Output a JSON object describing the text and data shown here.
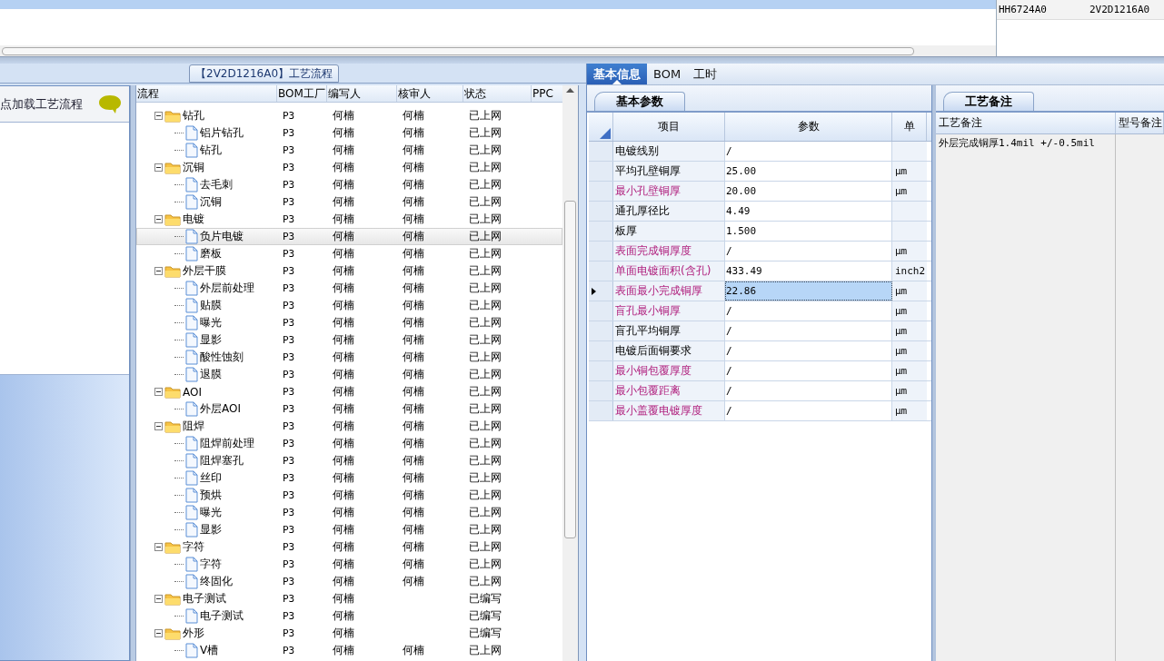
{
  "top_grid": {
    "right_row": [
      "HH6724A0",
      "2V2D1216A0"
    ]
  },
  "flow_panel": {
    "title": "【2V2D1216A0】工艺流程",
    "node_header": "点加载工艺流程",
    "columns": [
      "流程",
      "BOM工厂",
      "编写人",
      "核审人",
      "状态",
      "PPC"
    ],
    "tree": [
      {
        "name": "钻孔",
        "bom": "P3",
        "writer": "何楠",
        "reviewer": "何楠",
        "status": "已上网",
        "selected": false,
        "expanded": true,
        "children": [
          {
            "name": "铝片钻孔",
            "bom": "P3",
            "writer": "何楠",
            "reviewer": "何楠",
            "status": "已上网",
            "selected": false
          },
          {
            "name": "钻孔",
            "bom": "P3",
            "writer": "何楠",
            "reviewer": "何楠",
            "status": "已上网",
            "selected": false
          }
        ]
      },
      {
        "name": "沉铜",
        "bom": "P3",
        "writer": "何楠",
        "reviewer": "何楠",
        "status": "已上网",
        "selected": false,
        "expanded": true,
        "children": [
          {
            "name": "去毛刺",
            "bom": "P3",
            "writer": "何楠",
            "reviewer": "何楠",
            "status": "已上网",
            "selected": false
          },
          {
            "name": "沉铜",
            "bom": "P3",
            "writer": "何楠",
            "reviewer": "何楠",
            "status": "已上网",
            "selected": false
          }
        ]
      },
      {
        "name": "电镀",
        "bom": "P3",
        "writer": "何楠",
        "reviewer": "何楠",
        "status": "已上网",
        "selected": false,
        "expanded": true,
        "children": [
          {
            "name": "负片电镀",
            "bom": "P3",
            "writer": "何楠",
            "reviewer": "何楠",
            "status": "已上网",
            "selected": true
          },
          {
            "name": "磨板",
            "bom": "P3",
            "writer": "何楠",
            "reviewer": "何楠",
            "status": "已上网",
            "selected": false
          }
        ]
      },
      {
        "name": "外层干膜",
        "bom": "P3",
        "writer": "何楠",
        "reviewer": "何楠",
        "status": "已上网",
        "selected": false,
        "expanded": true,
        "children": [
          {
            "name": "外层前处理",
            "bom": "P3",
            "writer": "何楠",
            "reviewer": "何楠",
            "status": "已上网",
            "selected": false
          },
          {
            "name": "贴膜",
            "bom": "P3",
            "writer": "何楠",
            "reviewer": "何楠",
            "status": "已上网",
            "selected": false
          },
          {
            "name": "曝光",
            "bom": "P3",
            "writer": "何楠",
            "reviewer": "何楠",
            "status": "已上网",
            "selected": false
          },
          {
            "name": "显影",
            "bom": "P3",
            "writer": "何楠",
            "reviewer": "何楠",
            "status": "已上网",
            "selected": false
          },
          {
            "name": "酸性蚀刻",
            "bom": "P3",
            "writer": "何楠",
            "reviewer": "何楠",
            "status": "已上网",
            "selected": false
          },
          {
            "name": "退膜",
            "bom": "P3",
            "writer": "何楠",
            "reviewer": "何楠",
            "status": "已上网",
            "selected": false
          }
        ]
      },
      {
        "name": "AOI",
        "bom": "P3",
        "writer": "何楠",
        "reviewer": "何楠",
        "status": "已上网",
        "selected": false,
        "expanded": true,
        "children": [
          {
            "name": "外层AOI",
            "bom": "P3",
            "writer": "何楠",
            "reviewer": "何楠",
            "status": "已上网",
            "selected": false
          }
        ]
      },
      {
        "name": "阻焊",
        "bom": "P3",
        "writer": "何楠",
        "reviewer": "何楠",
        "status": "已上网",
        "selected": false,
        "expanded": true,
        "children": [
          {
            "name": "阻焊前处理",
            "bom": "P3",
            "writer": "何楠",
            "reviewer": "何楠",
            "status": "已上网",
            "selected": false
          },
          {
            "name": "阻焊塞孔",
            "bom": "P3",
            "writer": "何楠",
            "reviewer": "何楠",
            "status": "已上网",
            "selected": false
          },
          {
            "name": "丝印",
            "bom": "P3",
            "writer": "何楠",
            "reviewer": "何楠",
            "status": "已上网",
            "selected": false
          },
          {
            "name": "预烘",
            "bom": "P3",
            "writer": "何楠",
            "reviewer": "何楠",
            "status": "已上网",
            "selected": false
          },
          {
            "name": "曝光",
            "bom": "P3",
            "writer": "何楠",
            "reviewer": "何楠",
            "status": "已上网",
            "selected": false
          },
          {
            "name": "显影",
            "bom": "P3",
            "writer": "何楠",
            "reviewer": "何楠",
            "status": "已上网",
            "selected": false
          }
        ]
      },
      {
        "name": "字符",
        "bom": "P3",
        "writer": "何楠",
        "reviewer": "何楠",
        "status": "已上网",
        "selected": false,
        "expanded": true,
        "children": [
          {
            "name": "字符",
            "bom": "P3",
            "writer": "何楠",
            "reviewer": "何楠",
            "status": "已上网",
            "selected": false
          },
          {
            "name": "终固化",
            "bom": "P3",
            "writer": "何楠",
            "reviewer": "何楠",
            "status": "已上网",
            "selected": false
          }
        ]
      },
      {
        "name": "电子测试",
        "bom": "P3",
        "writer": "何楠",
        "status": "已编写",
        "selected": false,
        "expanded": true,
        "children": [
          {
            "name": "电子测试",
            "bom": "P3",
            "writer": "何楠",
            "status": "已编写",
            "selected": false
          }
        ]
      },
      {
        "name": "外形",
        "bom": "P3",
        "writer": "何楠",
        "status": "已编写",
        "selected": false,
        "expanded": true,
        "children": [
          {
            "name": "V槽",
            "bom": "P3",
            "writer": "何楠",
            "reviewer": "何楠",
            "status": "已上网",
            "selected": false
          }
        ]
      }
    ]
  },
  "detail_tabs": [
    {
      "label": "基本信息",
      "selected": true
    },
    {
      "label": "BOM",
      "selected": false
    },
    {
      "label": "工时",
      "selected": false
    }
  ],
  "params": {
    "tab": "基本参数",
    "columns": [
      "项目",
      "参数",
      "单"
    ],
    "rows": [
      {
        "item": "电镀线别",
        "value": "/",
        "highlighted": false,
        "selected": false
      },
      {
        "item": "平均孔壁铜厚",
        "value": "25.00",
        "unit": "μm",
        "highlighted": false,
        "selected": false
      },
      {
        "item": "最小孔壁铜厚",
        "value": "20.00",
        "unit": "μm",
        "highlighted": true,
        "selected": false
      },
      {
        "item": "通孔厚径比",
        "value": "4.49",
        "highlighted": false,
        "selected": false
      },
      {
        "item": "板厚",
        "value": "1.500",
        "highlighted": false,
        "selected": false
      },
      {
        "item": "表面完成铜厚度",
        "value": "/",
        "unit": "μm",
        "highlighted": true,
        "selected": false
      },
      {
        "item": "单面电镀面积(含孔)",
        "value": "433.49",
        "unit": "inch2",
        "highlighted": true,
        "selected": false
      },
      {
        "item": "表面最小完成铜厚",
        "value": "22.86",
        "unit": "μm",
        "highlighted": true,
        "selected": true
      },
      {
        "item": "盲孔最小铜厚",
        "value": "/",
        "unit": "μm",
        "highlighted": true,
        "selected": false
      },
      {
        "item": "盲孔平均铜厚",
        "value": "/",
        "unit": "μm",
        "highlighted": false,
        "selected": false
      },
      {
        "item": "电镀后面铜要求",
        "value": "/",
        "unit": "μm",
        "highlighted": false,
        "selected": false
      },
      {
        "item": "最小铜包覆厚度",
        "value": "/",
        "unit": "μm",
        "highlighted": true,
        "selected": false
      },
      {
        "item": "最小包覆距离",
        "value": "/",
        "unit": "μm",
        "highlighted": true,
        "selected": false
      },
      {
        "item": "最小盖覆电镀厚度",
        "value": "/",
        "unit": "μm",
        "highlighted": true,
        "selected": false
      }
    ]
  },
  "notes": {
    "tab": "工艺备注",
    "columns": [
      "工艺备注",
      "型号备注"
    ],
    "rows": [
      [
        "外层完成铜厚1.4mil +/-0.5mil"
      ]
    ]
  }
}
